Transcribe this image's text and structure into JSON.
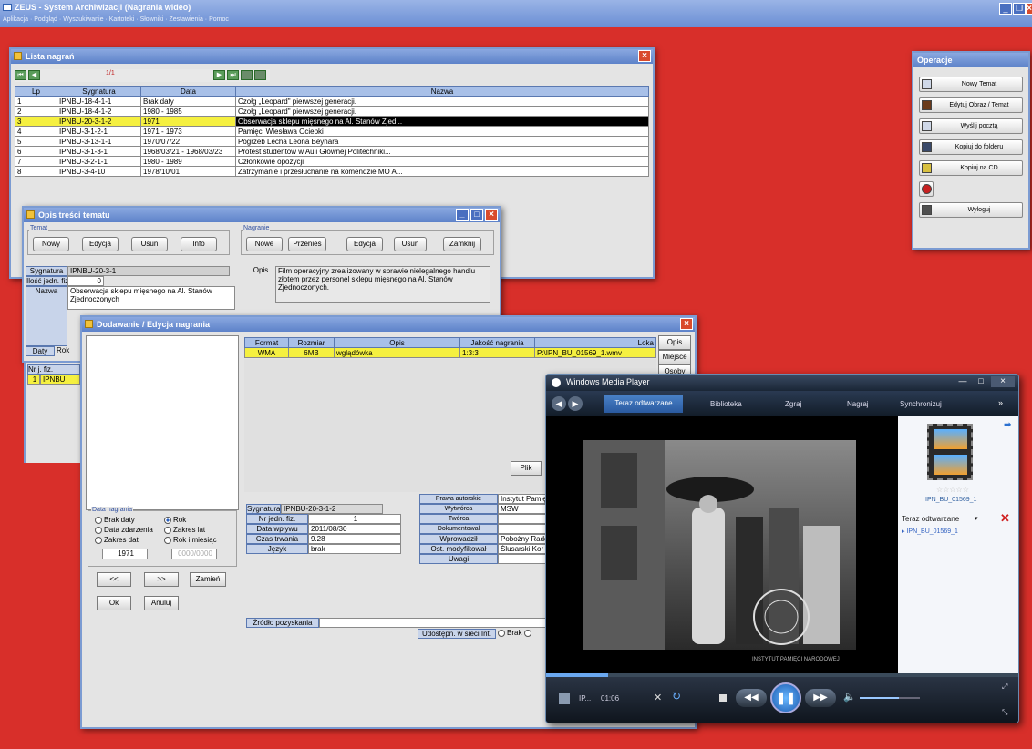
{
  "colors": {
    "desktop": "#d82f2a",
    "title_bar": "#5d82c9",
    "selection": "#f5f040",
    "header": "#a8c0e8",
    "wmp_bg": "#1a2430"
  },
  "main": {
    "title": "ZEUS - System Archiwizacji (Nagrania wideo)",
    "menu": [
      "Aplikacja",
      "Podgląd",
      "Wyszukiwanie",
      "Kartoteki",
      "Słowniki",
      "Zestawienia",
      "Pomoc"
    ]
  },
  "lista": {
    "title": "Lista nagrań",
    "pager": "1/1",
    "columns": [
      "Lp",
      "Sygnatura",
      "Data",
      "Nazwa"
    ],
    "rows": [
      [
        "1",
        "IPNBU-18-4-1-1",
        "Brak daty",
        "Czołg „Leopard\" pierwszej generacji."
      ],
      [
        "2",
        "IPNBU-18-4-1-2",
        "1980 - 1985",
        "Czołg „Leopard\" pierwszej generacji."
      ],
      [
        "3",
        "IPNBU-20-3-1-2",
        "1971",
        "Obserwacja sklepu mięsnego na Al. Stanów Zjed..."
      ],
      [
        "4",
        "IPNBU-3-1-2-1",
        "1971 - 1973",
        "Pamięci Wiesława Ociepki"
      ],
      [
        "5",
        "IPNBU-3-13-1-1",
        "1970/07/22",
        "Pogrzeb Lecha Leona Beynara"
      ],
      [
        "6",
        "IPNBU-3-1-3-1",
        "1968/03/21 - 1968/03/23",
        "Protest studentów w Auli Głównej Politechniki..."
      ],
      [
        "7",
        "IPNBU-3-2-1-1",
        "1980 - 1989",
        "Członkowie opozycji"
      ],
      [
        "8",
        "IPNBU-3-4-10",
        "1978/10/01",
        "Zatrzymanie i przesłuchanie na komendzie MO A..."
      ]
    ]
  },
  "opis": {
    "title": "Opis treści tematu",
    "temat_group": "Temat",
    "temat_buttons": [
      "Nowy",
      "Edycja",
      "Usuń",
      "Info"
    ],
    "nagranie_group": "Nagranie",
    "nagranie_buttons": [
      "Nowe",
      "Przenieś",
      "Edycja",
      "Usuń",
      "Zamknij"
    ],
    "sygnatura_label": "Sygnatura",
    "sygnatura": "IPNBU-20-3-1",
    "ilosc_label": "Ilość jedn. fiz.",
    "ilosc": "0",
    "nazwa_label": "Nazwa",
    "nazwa": "Obserwacja sklepu mięsnego na Al. Stanów Zjednoczonych",
    "opis_label": "Opis",
    "opis": "Film operacyjny zrealizowany w sprawie nielegalnego handlu złotem przez personel sklepu mięsnego na Al. Stanów Zjednoczonych.",
    "daty_label": "Daty",
    "rok_label": "Rok",
    "nrj_label": "Nr j. fiz.",
    "nrj_row_num": "1",
    "nrj_row_val": "IPNBU"
  },
  "dodawanie": {
    "title": "Dodawanie / Edycja nagrania",
    "columns": [
      "Format",
      "Rozmiar",
      "Opis",
      "Jakość nagrania",
      "Loka"
    ],
    "row": [
      "WMA",
      "6MB",
      "wglądówka",
      "1:3:3",
      "P:\\IPN_BU_01569_1.wmv"
    ],
    "side_buttons": [
      "Opis",
      "Miejsce",
      "Osoby"
    ],
    "plik_button": "Plik",
    "data_group": "Data nagrania",
    "radios": [
      {
        "label": "Brak daty",
        "on": false
      },
      {
        "label": "Rok",
        "on": true
      },
      {
        "label": "Data zdarzenia",
        "on": false
      },
      {
        "label": "Zakres lat",
        "on": false
      },
      {
        "label": "Zakres dat",
        "on": false
      },
      {
        "label": "Rok i miesiąc",
        "on": false
      }
    ],
    "year": "1971",
    "year_month_placeholder": "0000/0000",
    "nav_prev": "<<",
    "nav_next": ">>",
    "zamien": "Zamień",
    "ok": "Ok",
    "anuluj": "Anuluj",
    "fields": [
      [
        "Sygnatura",
        "IPNBU-20-3-1-2"
      ],
      [
        "Nr jedn. fiz.",
        "1"
      ],
      [
        "Data wpływu",
        "2011/08/30"
      ],
      [
        "Czas trwania",
        "9.28"
      ],
      [
        "Język",
        "brak"
      ]
    ],
    "right_fields": [
      [
        "Prawa autorskie",
        "Instytut Pamię"
      ],
      [
        "Wytwórca",
        "MSW"
      ],
      [
        "Twórca",
        ""
      ],
      [
        "Dokumentował",
        ""
      ],
      [
        "Wprowadził",
        "Pobożny Rado"
      ],
      [
        "Ost. modyfikował",
        "Ślusarski Kor"
      ],
      [
        "Uwagi",
        ""
      ]
    ],
    "zrodlo_label": "Źródło pozyskania",
    "udostepn_label": "Udostępn. w sieci Int.",
    "brak_label": "Brak"
  },
  "operacje": {
    "title": "Operacje",
    "items": [
      {
        "label": "Nowy Temat",
        "icon": "new-document-icon"
      },
      {
        "label": "Edytuj Obraz / Temat",
        "icon": "edit-icon"
      },
      {
        "label": "Wyślij pocztą",
        "icon": "mail-icon"
      },
      {
        "label": "Kopiuj do folderu",
        "icon": "folder-copy-icon"
      },
      {
        "label": "Kopiuj na CD",
        "icon": "cd-icon"
      },
      {
        "label": "",
        "icon": "record-icon"
      },
      {
        "label": "Wyloguj",
        "icon": "logout-icon"
      }
    ]
  },
  "wmp": {
    "title": "Windows Media Player",
    "tabs": [
      "Teraz odtwarzane",
      "Biblioteka",
      "Zgraj",
      "Nagraj",
      "Synchronizuj"
    ],
    "file_name": "IPN_BU_01569_1",
    "now_playing_label": "Teraz odtwarzane",
    "playlist_item": "IPN_BU_01569_1",
    "status_text": "IP...",
    "time": "01:06",
    "progress": 0.13,
    "volume": 0.65,
    "stamp_text": "INSTYTUT PAMIĘCI NARODOWEJ"
  }
}
